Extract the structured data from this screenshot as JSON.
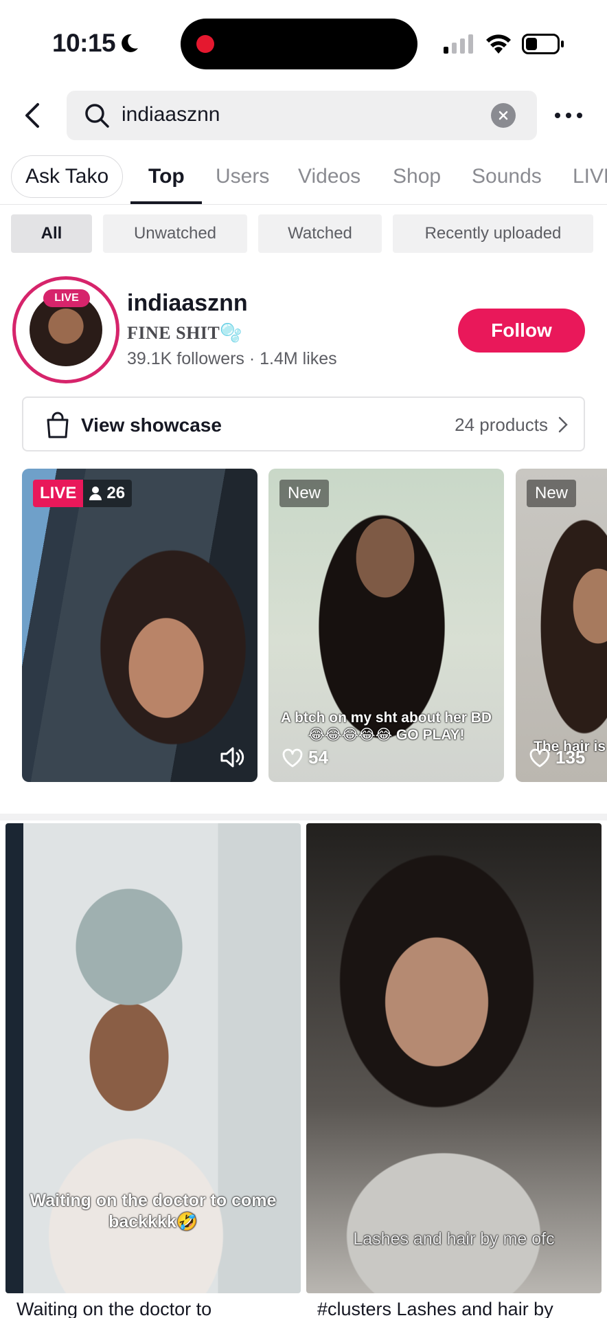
{
  "status_bar": {
    "time": "10:15"
  },
  "search": {
    "query": "indiaasznn"
  },
  "tabs": {
    "ask_tako": "Ask Tako",
    "items": [
      "Top",
      "Users",
      "Videos",
      "Shop",
      "Sounds",
      "LIVE"
    ],
    "active": "Top"
  },
  "filters": [
    "All",
    "Unwatched",
    "Watched",
    "Recently uploaded"
  ],
  "user": {
    "live_label": "LIVE",
    "username": "indiaasznn",
    "bio": "FINE SHIT🫧",
    "stats": "39.1K followers · 1.4M likes",
    "follow_label": "Follow"
  },
  "showcase": {
    "label": "View showcase",
    "count": "24 products"
  },
  "top_cards": [
    {
      "badge": "LIVE",
      "viewers": "26"
    },
    {
      "badge": "New",
      "caption": "A btch on my sht about her BD 😂😂😂😂😂 GO PLAY!",
      "likes": "54"
    },
    {
      "badge": "New",
      "caption": "The hair is b",
      "likes": "135"
    }
  ],
  "grid_cards": [
    {
      "overlay": "Waiting on the doctor to come backkkk🤣",
      "title": "Waiting on the doctor to"
    },
    {
      "overlay": "Lashes and hair by me ofc",
      "title": "#clusters Lashes and hair by"
    }
  ],
  "colors": {
    "brand": "#e9185a",
    "live_ring": "#d6246b"
  }
}
